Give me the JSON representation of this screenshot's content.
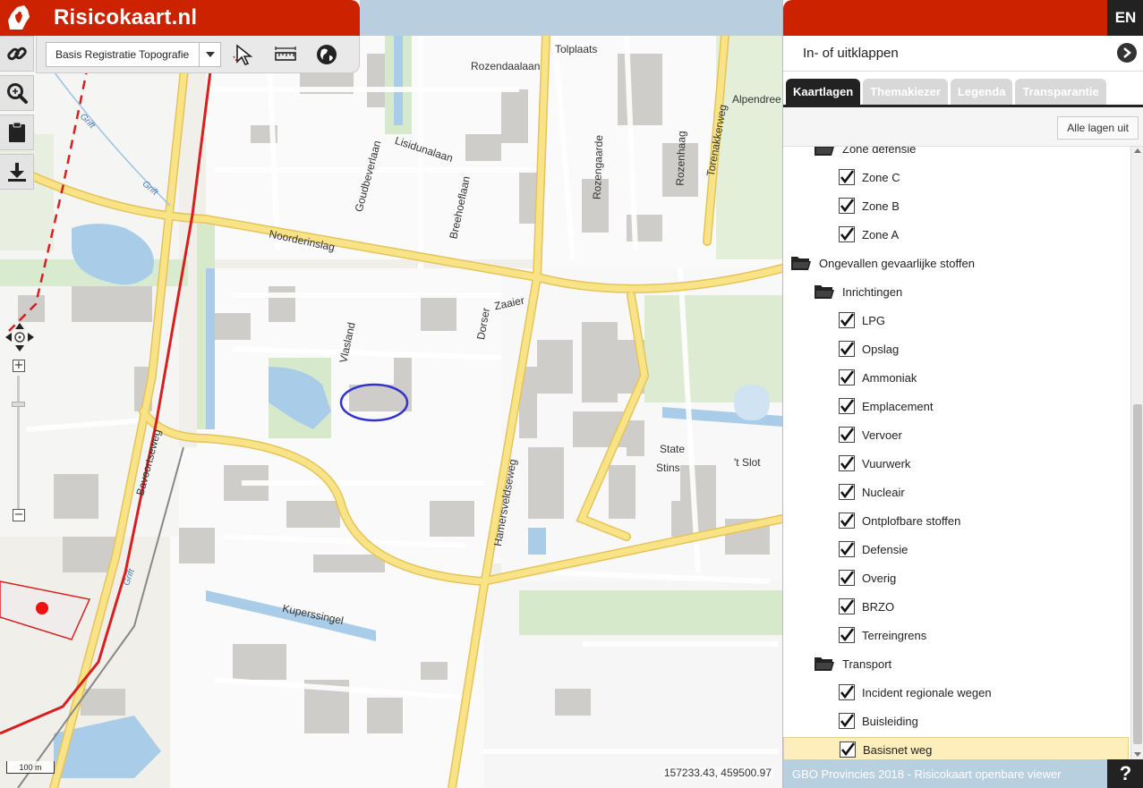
{
  "header": {
    "title": "Risicokaart.nl",
    "lang_button": "EN"
  },
  "toolbar": {
    "layer_select_value": "Basis Registratie Topografie"
  },
  "map": {
    "labels": {
      "tolplaats": "Tolplaats",
      "rozendaalaan": "Rozendaalaan",
      "alpendree": "Alpendree",
      "lisidunalaan": "Lisidunalaan",
      "goudbeverlaan": "Goudbeverlaan",
      "breehoeflaan": "Breehoeflaan",
      "rozengaarde": "Rozengaarde",
      "rozenhaag": "Rozenhaag",
      "torenakkerweg": "Torenakkerweg",
      "noorderinslag": "Noorderinslag",
      "zaaier": "Zaaier",
      "dorser": "Dorser",
      "vlasland": "Vlasland",
      "state": "State",
      "stins": "Stins",
      "tslot": "'t Slot",
      "bavoortseweg": "Bavoortseweg",
      "hamersveldseweg": "Hamersveldseweg",
      "kuperssingel": "Kuperssingel",
      "grift1": "Grift",
      "grift2": "Grift",
      "grift3": "Grift"
    },
    "scalebar": "100 m",
    "coordinates": "157233.43, 459500.97"
  },
  "panel": {
    "collapse_label": "In- of uitklappen",
    "tabs": [
      "Kaartlagen",
      "Themakiezer",
      "Legenda",
      "Transparantie"
    ],
    "all_layers_off": "Alle lagen uit",
    "footer": "GBO Provincies 2018 - Risicokaart openbare viewer",
    "help": "?",
    "rows": [
      {
        "type": "folder",
        "label": "Zone defensie",
        "level": 1
      },
      {
        "type": "check",
        "label": "Zone C",
        "level": 2
      },
      {
        "type": "check",
        "label": "Zone B",
        "level": 2
      },
      {
        "type": "check",
        "label": "Zone A",
        "level": 2
      },
      {
        "type": "folder",
        "label": "Ongevallen gevaarlijke stoffen",
        "level": 0
      },
      {
        "type": "folder",
        "label": "Inrichtingen",
        "level": 1
      },
      {
        "type": "check",
        "label": "LPG",
        "level": 2
      },
      {
        "type": "check",
        "label": "Opslag",
        "level": 2
      },
      {
        "type": "check",
        "label": "Ammoniak",
        "level": 2
      },
      {
        "type": "check",
        "label": "Emplacement",
        "level": 2
      },
      {
        "type": "check",
        "label": "Vervoer",
        "level": 2
      },
      {
        "type": "check",
        "label": "Vuurwerk",
        "level": 2
      },
      {
        "type": "check",
        "label": "Nucleair",
        "level": 2
      },
      {
        "type": "check",
        "label": "Ontplofbare stoffen",
        "level": 2
      },
      {
        "type": "check",
        "label": "Defensie",
        "level": 2
      },
      {
        "type": "check",
        "label": "Overig",
        "level": 2
      },
      {
        "type": "check",
        "label": "BRZO",
        "level": 2
      },
      {
        "type": "check",
        "label": "Terreingrens",
        "level": 2
      },
      {
        "type": "folder",
        "label": "Transport",
        "level": 1
      },
      {
        "type": "check",
        "label": "Incident regionale wegen",
        "level": 2
      },
      {
        "type": "check",
        "label": "Buisleiding",
        "level": 2
      },
      {
        "type": "check",
        "label": "Basisnet weg",
        "level": 2,
        "highlight": true
      }
    ]
  },
  "colors": {
    "brand_red": "#cc2200",
    "road_yellow": "#f7e27a",
    "water": "#a8cbe6",
    "green": "#d3e8c8",
    "building": "#d5d3cf",
    "highlight_ellipse": "#3333cc"
  }
}
